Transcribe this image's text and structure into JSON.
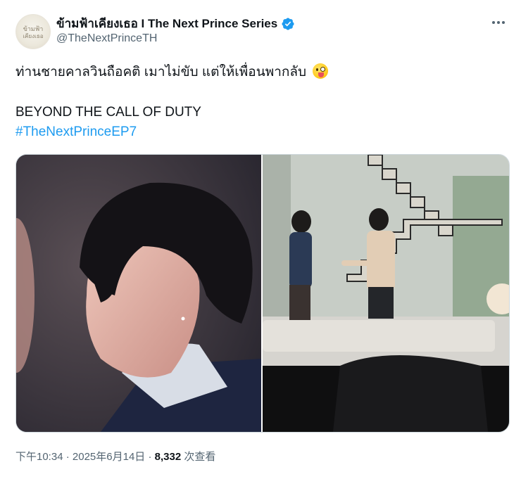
{
  "author": {
    "display_name": "ข้ามฟ้าเคียงเธอ I The Next Prince Series",
    "handle": "@TheNextPrinceTH",
    "avatar_text": "ข้ามฟ้า\nเคียงเธอ",
    "verified": true
  },
  "tweet": {
    "line1": "ท่านชายคาลวินถือคติ เมาไม่ขับ แต่ให้เพื่อนพากลับ",
    "line2": "BEYOND THE CALL OF DUTY",
    "hashtag": "#TheNextPrinceEP7",
    "emoji": "winking-face-with-tongue"
  },
  "footer": {
    "time": "下午10:34",
    "sep1": " · ",
    "date": "2025年6月14日",
    "sep2": " · ",
    "views": "8,332",
    "views_label": " 次查看"
  },
  "colors": {
    "link": "#1d9bf0",
    "verified": "#1d9bf0",
    "secondary_text": "#536471"
  }
}
